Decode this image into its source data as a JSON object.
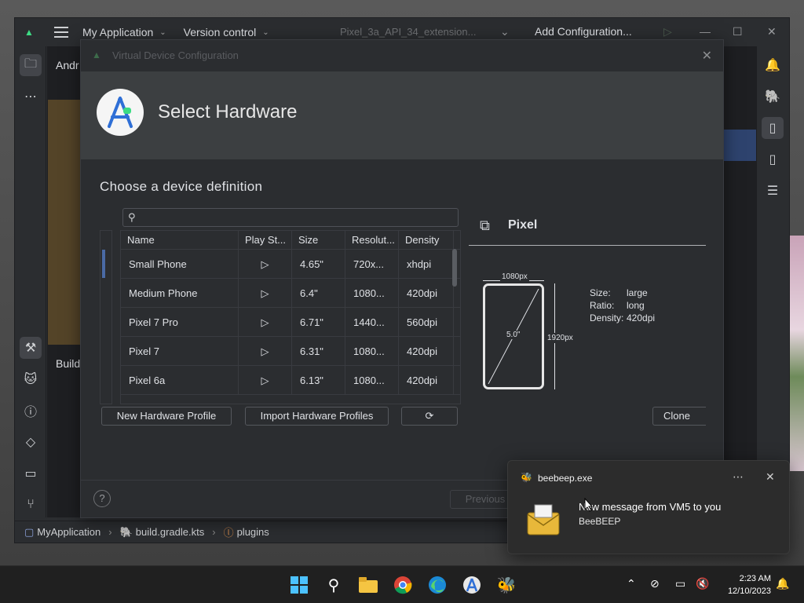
{
  "ide": {
    "menu": [
      "My Application",
      "Version control"
    ],
    "run_config": "Pixel_3a_API_34_extension...",
    "add_config": "Add Configuration...",
    "project_label": "Andr",
    "build_label": "Build"
  },
  "statusbar": {
    "crumbs": [
      "MyApplication",
      "build.gradle.kts",
      "plugins"
    ]
  },
  "dialog": {
    "window_title": "Virtual Device Configuration",
    "heading": "Select Hardware",
    "subheading": "Choose a device definition",
    "search_placeholder": "",
    "columns": [
      "Name",
      "Play St...",
      "Size",
      "Resolut...",
      "Density"
    ],
    "rows": [
      {
        "name": "Small Phone",
        "size": "4.65\"",
        "resolution": "720x...",
        "density": "xhdpi"
      },
      {
        "name": "Medium Phone",
        "size": "6.4\"",
        "resolution": "1080...",
        "density": "420dpi"
      },
      {
        "name": "Pixel 7 Pro",
        "size": "6.71\"",
        "resolution": "1440...",
        "density": "560dpi"
      },
      {
        "name": "Pixel 7",
        "size": "6.31\"",
        "resolution": "1080...",
        "density": "420dpi"
      },
      {
        "name": "Pixel 6a",
        "size": "6.13\"",
        "resolution": "1080...",
        "density": "420dpi"
      }
    ],
    "buttons": {
      "new_profile": "New Hardware Profile",
      "import_profiles": "Import Hardware Profiles",
      "clone": "Clone De",
      "previous": "Previous"
    },
    "preview": {
      "name": "Pixel",
      "width_px": "1080px",
      "height_px": "1920px",
      "diagonal": "5.0\"",
      "size_label": "Size:",
      "size_value": "large",
      "ratio_label": "Ratio:",
      "ratio_value": "long",
      "density_label": "Density:",
      "density_value": "420dpi"
    }
  },
  "notification": {
    "app": "beebeep.exe",
    "message": "New message from VM5 to you",
    "sender": "BeeBEEP"
  },
  "taskbar": {
    "time": "2:23 AM",
    "date": "12/10/2023"
  },
  "colors": {
    "ide_bg": "#2b2d30",
    "header_bg": "#3c3f41",
    "accent_green": "#3ddc84",
    "selection_blue": "#2e436e"
  }
}
